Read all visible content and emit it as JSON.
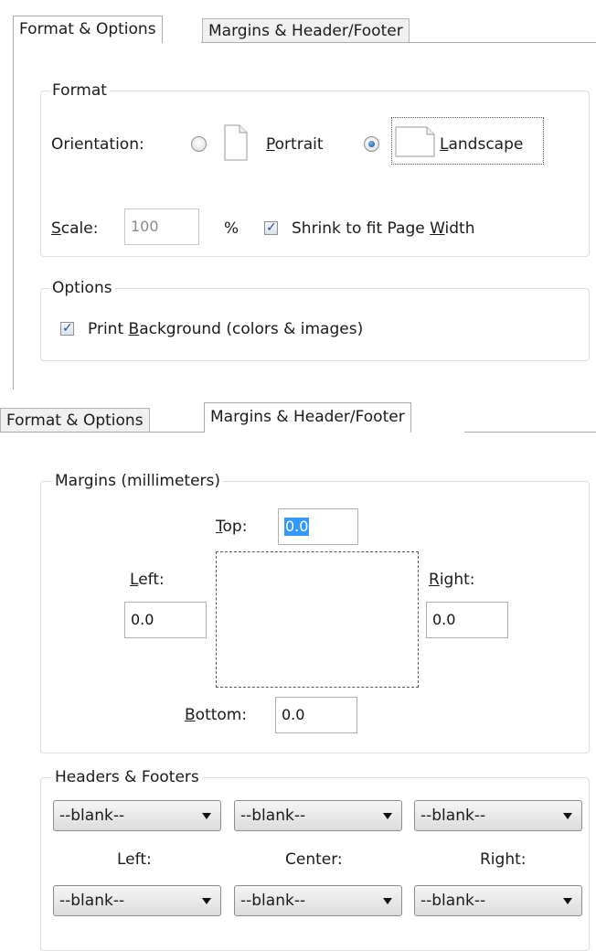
{
  "top": {
    "tabs": [
      {
        "label": "Format & Options",
        "active": true
      },
      {
        "label": "Margins & Header/Footer",
        "active": false
      }
    ],
    "format_group": {
      "legend": "Format",
      "orientation_label": "Orientation:",
      "portrait_label": "Portrait",
      "landscape_label": "Landscape",
      "selected_orientation": "Landscape",
      "scale_label": "Scale:",
      "scale_value": "100",
      "percent": "%",
      "shrink_label": "Shrink to fit Page Width",
      "shrink_checked": true
    },
    "options_group": {
      "legend": "Options",
      "print_bg_label": "Print Background (colors & images)",
      "print_bg_checked": true
    }
  },
  "bottom": {
    "tabs": [
      {
        "label": "Format & Options",
        "active": false
      },
      {
        "label": "Margins & Header/Footer",
        "active": true
      }
    ],
    "margins_group": {
      "legend": "Margins (millimeters)",
      "top_label": "Top:",
      "top_value": "0.0",
      "left_label": "Left:",
      "left_value": "0.0",
      "right_label": "Right:",
      "right_value": "0.0",
      "bottom_label": "Bottom:",
      "bottom_value": "0.0"
    },
    "hf_group": {
      "legend": "Headers & Footers",
      "headers": [
        "--blank--",
        "--blank--",
        "--blank--"
      ],
      "column_labels": [
        "Left:",
        "Center:",
        "Right:"
      ],
      "footers": [
        "--blank--",
        "--blank--",
        "--blank--"
      ]
    }
  },
  "colors": {
    "selection": "#3399ff",
    "group_border": "#d5dfe5",
    "radio_dot": "#1c5fb0"
  }
}
